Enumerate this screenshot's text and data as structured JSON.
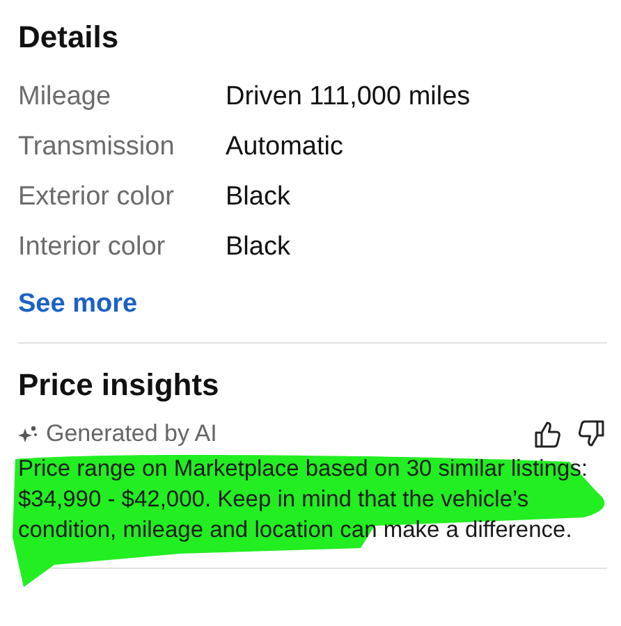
{
  "details": {
    "title": "Details",
    "rows": [
      {
        "label": "Mileage",
        "value": "Driven 111,000 miles"
      },
      {
        "label": "Transmission",
        "value": "Automatic"
      },
      {
        "label": "Exterior color",
        "value": "Black"
      },
      {
        "label": "Interior color",
        "value": "Black"
      }
    ],
    "link": "See more"
  },
  "price_insights": {
    "title": "Price insights",
    "source": "Generated by AI",
    "highlighted": true,
    "text": "Price range on Marketplace based on 30 similar listings: $34,990 - $42,000. Keep in mind that the vehicle’s condition, mileage and location can make a difference."
  }
}
